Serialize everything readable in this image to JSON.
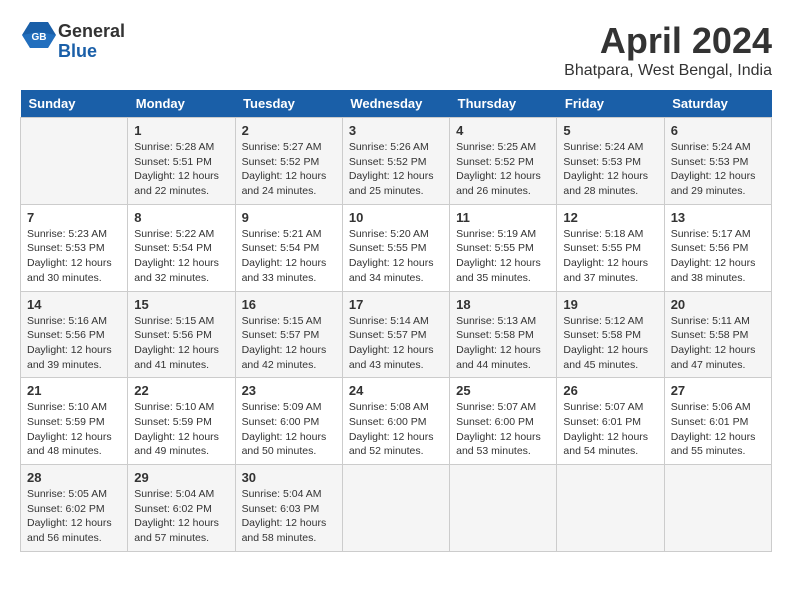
{
  "header": {
    "logo": {
      "line1": "General",
      "line2": "Blue"
    },
    "title": "April 2024",
    "location": "Bhatpara, West Bengal, India"
  },
  "weekdays": [
    "Sunday",
    "Monday",
    "Tuesday",
    "Wednesday",
    "Thursday",
    "Friday",
    "Saturday"
  ],
  "weeks": [
    [
      {
        "day": "",
        "info": ""
      },
      {
        "day": "1",
        "info": "Sunrise: 5:28 AM\nSunset: 5:51 PM\nDaylight: 12 hours\nand 22 minutes."
      },
      {
        "day": "2",
        "info": "Sunrise: 5:27 AM\nSunset: 5:52 PM\nDaylight: 12 hours\nand 24 minutes."
      },
      {
        "day": "3",
        "info": "Sunrise: 5:26 AM\nSunset: 5:52 PM\nDaylight: 12 hours\nand 25 minutes."
      },
      {
        "day": "4",
        "info": "Sunrise: 5:25 AM\nSunset: 5:52 PM\nDaylight: 12 hours\nand 26 minutes."
      },
      {
        "day": "5",
        "info": "Sunrise: 5:24 AM\nSunset: 5:53 PM\nDaylight: 12 hours\nand 28 minutes."
      },
      {
        "day": "6",
        "info": "Sunrise: 5:24 AM\nSunset: 5:53 PM\nDaylight: 12 hours\nand 29 minutes."
      }
    ],
    [
      {
        "day": "7",
        "info": "Sunrise: 5:23 AM\nSunset: 5:53 PM\nDaylight: 12 hours\nand 30 minutes."
      },
      {
        "day": "8",
        "info": "Sunrise: 5:22 AM\nSunset: 5:54 PM\nDaylight: 12 hours\nand 32 minutes."
      },
      {
        "day": "9",
        "info": "Sunrise: 5:21 AM\nSunset: 5:54 PM\nDaylight: 12 hours\nand 33 minutes."
      },
      {
        "day": "10",
        "info": "Sunrise: 5:20 AM\nSunset: 5:55 PM\nDaylight: 12 hours\nand 34 minutes."
      },
      {
        "day": "11",
        "info": "Sunrise: 5:19 AM\nSunset: 5:55 PM\nDaylight: 12 hours\nand 35 minutes."
      },
      {
        "day": "12",
        "info": "Sunrise: 5:18 AM\nSunset: 5:55 PM\nDaylight: 12 hours\nand 37 minutes."
      },
      {
        "day": "13",
        "info": "Sunrise: 5:17 AM\nSunset: 5:56 PM\nDaylight: 12 hours\nand 38 minutes."
      }
    ],
    [
      {
        "day": "14",
        "info": "Sunrise: 5:16 AM\nSunset: 5:56 PM\nDaylight: 12 hours\nand 39 minutes."
      },
      {
        "day": "15",
        "info": "Sunrise: 5:15 AM\nSunset: 5:56 PM\nDaylight: 12 hours\nand 41 minutes."
      },
      {
        "day": "16",
        "info": "Sunrise: 5:15 AM\nSunset: 5:57 PM\nDaylight: 12 hours\nand 42 minutes."
      },
      {
        "day": "17",
        "info": "Sunrise: 5:14 AM\nSunset: 5:57 PM\nDaylight: 12 hours\nand 43 minutes."
      },
      {
        "day": "18",
        "info": "Sunrise: 5:13 AM\nSunset: 5:58 PM\nDaylight: 12 hours\nand 44 minutes."
      },
      {
        "day": "19",
        "info": "Sunrise: 5:12 AM\nSunset: 5:58 PM\nDaylight: 12 hours\nand 45 minutes."
      },
      {
        "day": "20",
        "info": "Sunrise: 5:11 AM\nSunset: 5:58 PM\nDaylight: 12 hours\nand 47 minutes."
      }
    ],
    [
      {
        "day": "21",
        "info": "Sunrise: 5:10 AM\nSunset: 5:59 PM\nDaylight: 12 hours\nand 48 minutes."
      },
      {
        "day": "22",
        "info": "Sunrise: 5:10 AM\nSunset: 5:59 PM\nDaylight: 12 hours\nand 49 minutes."
      },
      {
        "day": "23",
        "info": "Sunrise: 5:09 AM\nSunset: 6:00 PM\nDaylight: 12 hours\nand 50 minutes."
      },
      {
        "day": "24",
        "info": "Sunrise: 5:08 AM\nSunset: 6:00 PM\nDaylight: 12 hours\nand 52 minutes."
      },
      {
        "day": "25",
        "info": "Sunrise: 5:07 AM\nSunset: 6:00 PM\nDaylight: 12 hours\nand 53 minutes."
      },
      {
        "day": "26",
        "info": "Sunrise: 5:07 AM\nSunset: 6:01 PM\nDaylight: 12 hours\nand 54 minutes."
      },
      {
        "day": "27",
        "info": "Sunrise: 5:06 AM\nSunset: 6:01 PM\nDaylight: 12 hours\nand 55 minutes."
      }
    ],
    [
      {
        "day": "28",
        "info": "Sunrise: 5:05 AM\nSunset: 6:02 PM\nDaylight: 12 hours\nand 56 minutes."
      },
      {
        "day": "29",
        "info": "Sunrise: 5:04 AM\nSunset: 6:02 PM\nDaylight: 12 hours\nand 57 minutes."
      },
      {
        "day": "30",
        "info": "Sunrise: 5:04 AM\nSunset: 6:03 PM\nDaylight: 12 hours\nand 58 minutes."
      },
      {
        "day": "",
        "info": ""
      },
      {
        "day": "",
        "info": ""
      },
      {
        "day": "",
        "info": ""
      },
      {
        "day": "",
        "info": ""
      }
    ]
  ]
}
